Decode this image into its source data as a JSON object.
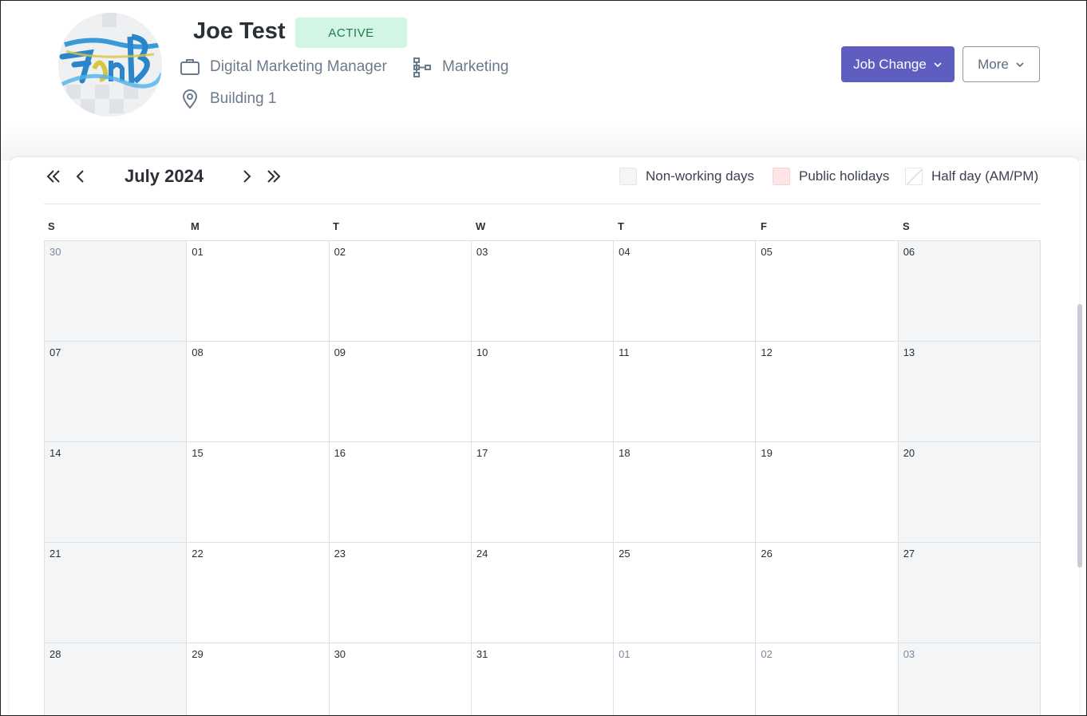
{
  "employee": {
    "name": "Joe Test",
    "status": "ACTIVE",
    "job_title": "Digital Marketing Manager",
    "department": "Marketing",
    "location": "Building 1",
    "avatar_icon": "company-logo-avatar"
  },
  "actions": {
    "job_change_label": "Job Change",
    "more_label": "More",
    "accent_color": "#5d5ec0"
  },
  "calendar": {
    "month_label": "July 2024",
    "legend": {
      "non_working": "Non-working days",
      "public_holidays": "Public holidays",
      "half_day": "Half day (AM/PM)"
    },
    "weekdays": [
      "S",
      "M",
      "T",
      "W",
      "T",
      "F",
      "S"
    ],
    "weeks": [
      [
        {
          "d": "30",
          "o": true
        },
        {
          "d": "01"
        },
        {
          "d": "02"
        },
        {
          "d": "03"
        },
        {
          "d": "04"
        },
        {
          "d": "05"
        },
        {
          "d": "06"
        }
      ],
      [
        {
          "d": "07"
        },
        {
          "d": "08"
        },
        {
          "d": "09"
        },
        {
          "d": "10"
        },
        {
          "d": "11"
        },
        {
          "d": "12"
        },
        {
          "d": "13"
        }
      ],
      [
        {
          "d": "14"
        },
        {
          "d": "15"
        },
        {
          "d": "16"
        },
        {
          "d": "17"
        },
        {
          "d": "18"
        },
        {
          "d": "19"
        },
        {
          "d": "20"
        }
      ],
      [
        {
          "d": "21"
        },
        {
          "d": "22"
        },
        {
          "d": "23"
        },
        {
          "d": "24"
        },
        {
          "d": "25"
        },
        {
          "d": "26"
        },
        {
          "d": "27"
        }
      ],
      [
        {
          "d": "28"
        },
        {
          "d": "29"
        },
        {
          "d": "30"
        },
        {
          "d": "31"
        },
        {
          "d": "01",
          "o": true
        },
        {
          "d": "02",
          "o": true
        },
        {
          "d": "03",
          "o": true
        }
      ]
    ]
  }
}
